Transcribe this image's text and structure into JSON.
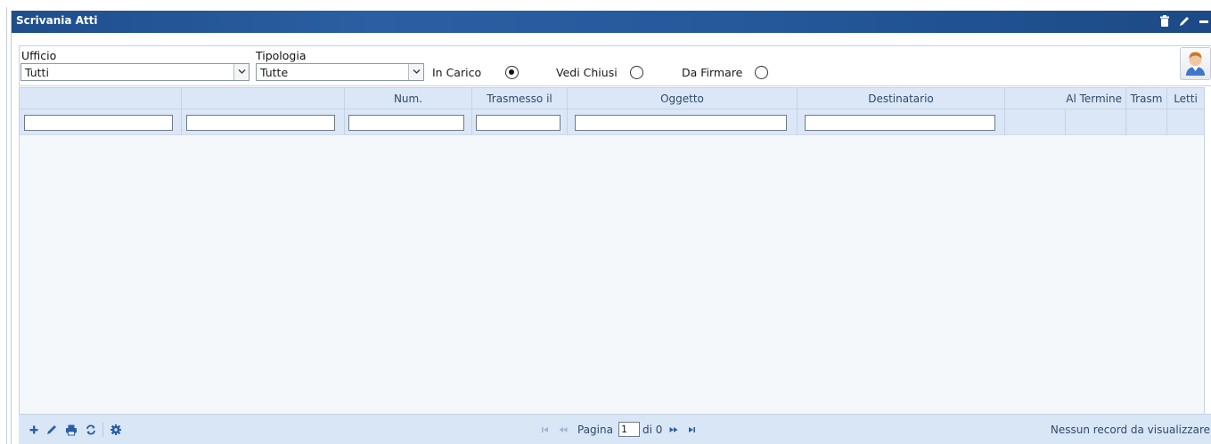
{
  "window": {
    "title": "Scrivania Atti"
  },
  "filters": {
    "ufficio_label": "Ufficio",
    "ufficio_value": "Tutti",
    "tipologia_label": "Tipologia",
    "tipologia_value": "Tutte",
    "radios": [
      {
        "label": "In Carico",
        "checked": true
      },
      {
        "label": "Vedi Chiusi",
        "checked": false
      },
      {
        "label": "Da Firmare",
        "checked": false
      }
    ]
  },
  "grid": {
    "columns": [
      "",
      "",
      "Num.",
      "Trasmesso il",
      "Oggetto",
      "Destinatario",
      "Al Termine",
      "Trasm",
      "Letti"
    ]
  },
  "pager": {
    "page_label": "Pagina",
    "page_value": "1",
    "of_label": "di 0",
    "status": "Nessun record da visualizzare"
  },
  "colors": {
    "titlebar": "#24599c",
    "header_bg": "#dbe7f6",
    "pager_bg": "#d9e6f6",
    "icon_blue": "#2a5fa3"
  },
  "icons": {
    "titlebar": [
      "trash-icon",
      "pencil-icon",
      "minimize-icon"
    ],
    "toolbar": [
      "plus-icon",
      "pencil-icon",
      "print-icon",
      "refresh-icon",
      "gear-icon"
    ],
    "pager": [
      "first-page-icon",
      "prev-page-icon",
      "next-page-icon",
      "last-page-icon"
    ]
  }
}
